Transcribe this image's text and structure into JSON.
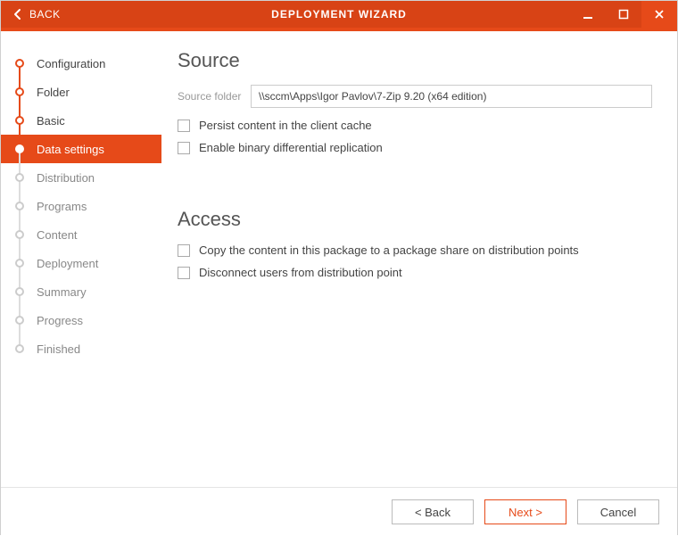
{
  "titlebar": {
    "back_label": "BACK",
    "title": "DEPLOYMENT WIZARD"
  },
  "sidebar": {
    "steps": [
      {
        "label": "Configuration",
        "state": "done"
      },
      {
        "label": "Folder",
        "state": "done"
      },
      {
        "label": "Basic",
        "state": "done"
      },
      {
        "label": "Data settings",
        "state": "current"
      },
      {
        "label": "Distribution",
        "state": "pending"
      },
      {
        "label": "Programs",
        "state": "pending"
      },
      {
        "label": "Content",
        "state": "pending"
      },
      {
        "label": "Deployment",
        "state": "pending"
      },
      {
        "label": "Summary",
        "state": "pending"
      },
      {
        "label": "Progress",
        "state": "pending"
      },
      {
        "label": "Finished",
        "state": "pending"
      }
    ]
  },
  "main": {
    "source": {
      "title": "Source",
      "folder_label": "Source folder",
      "folder_value": "\\\\sccm\\Apps\\Igor Pavlov\\7-Zip 9.20 (x64 edition)",
      "persist_label": "Persist content in the client cache",
      "binary_diff_label": "Enable binary differential replication"
    },
    "access": {
      "title": "Access",
      "copy_label": "Copy the content in this package to a package share on distribution points",
      "disconnect_label": "Disconnect users from distribution point"
    }
  },
  "footer": {
    "back": "< Back",
    "next": "Next >",
    "cancel": "Cancel"
  },
  "colors": {
    "accent": "#e64a19",
    "accent_dark": "#d84315"
  }
}
